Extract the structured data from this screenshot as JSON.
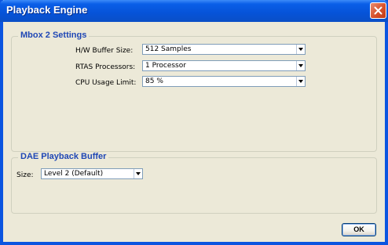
{
  "window": {
    "title": "Playback Engine"
  },
  "mbox_settings": {
    "label": "Mbox 2 Settings",
    "hw_buffer_size": {
      "label": "H/W Buffer Size:",
      "value": "512 Samples"
    },
    "rtas_processors": {
      "label": "RTAS Processors:",
      "value": "1 Processor"
    },
    "cpu_usage_limit": {
      "label": "CPU Usage Limit:",
      "value": "85 %"
    }
  },
  "dae_playback_buffer": {
    "label": "DAE Playback Buffer",
    "size": {
      "label": "Size:",
      "value": "Level 2 (Default)"
    }
  },
  "buttons": {
    "ok_label": "OK"
  },
  "colors": {
    "title_bar": "#0653d8",
    "group_label": "#1f47b5",
    "dialog_background": "#ece9d8",
    "close_button": "#d7512b"
  },
  "icons": {
    "close": "close-icon",
    "dropdown": "chevron-down-icon"
  }
}
